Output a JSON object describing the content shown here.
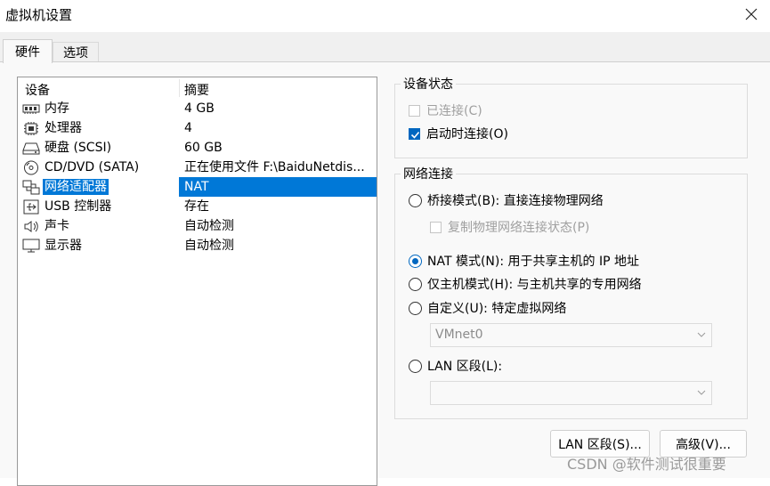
{
  "window": {
    "title": "虚拟机设置",
    "close_icon": "close-icon"
  },
  "tabs": [
    {
      "label": "硬件"
    },
    {
      "label": "选项"
    }
  ],
  "device_list": {
    "columns": {
      "device": "设备",
      "summary": "摘要"
    },
    "rows": [
      {
        "icon": "memory-icon",
        "name": "内存",
        "value": "4 GB"
      },
      {
        "icon": "processor-icon",
        "name": "处理器",
        "value": "4"
      },
      {
        "icon": "harddisk-icon",
        "name": "硬盘 (SCSI)",
        "value": "60 GB"
      },
      {
        "icon": "cd-dvd-icon",
        "name": "CD/DVD (SATA)",
        "value": "正在使用文件 F:\\BaiduNetdis..."
      },
      {
        "icon": "network-adapter-icon",
        "name": "网络适配器",
        "value": "NAT",
        "selected": true
      },
      {
        "icon": "usb-icon",
        "name": "USB 控制器",
        "value": "存在"
      },
      {
        "icon": "sound-icon",
        "name": "声卡",
        "value": "自动检测"
      },
      {
        "icon": "display-icon",
        "name": "显示器",
        "value": "自动检测"
      }
    ]
  },
  "device_status": {
    "legend": "设备状态",
    "connected": {
      "label": "已连接(C)",
      "checked": false,
      "enabled": false
    },
    "connect_at_power_on": {
      "label": "启动时连接(O)",
      "checked": true,
      "enabled": true
    }
  },
  "network_connection": {
    "legend": "网络连接",
    "bridged": {
      "label": "桥接模式(B): 直接连接物理网络",
      "selected": false
    },
    "replicate": {
      "label": "复制物理网络连接状态(P)",
      "checked": false,
      "enabled": false
    },
    "nat": {
      "label": "NAT 模式(N): 用于共享主机的 IP 地址",
      "selected": true
    },
    "host_only": {
      "label": "仅主机模式(H): 与主机共享的专用网络",
      "selected": false
    },
    "custom": {
      "label": "自定义(U): 特定虚拟网络",
      "selected": false
    },
    "custom_select": {
      "value": "VMnet0"
    },
    "lan_segment": {
      "label": "LAN 区段(L):",
      "selected": false
    },
    "lan_select": {
      "value": ""
    }
  },
  "buttons": {
    "lan_segments": "LAN 区段(S)...",
    "advanced": "高级(V)..."
  },
  "watermark": "CSDN @软件测试很重要"
}
